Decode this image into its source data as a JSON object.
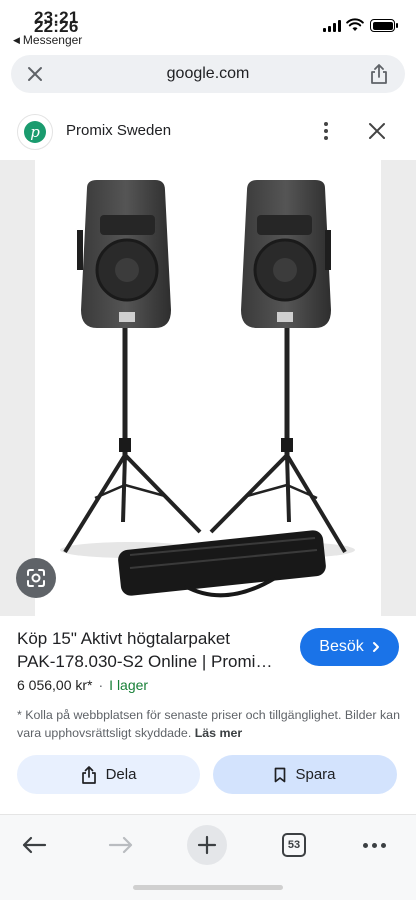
{
  "status_bar": {
    "time_top": "23:21",
    "time_bottom": "22:26",
    "back_app": "Messenger"
  },
  "address_bar": {
    "url": "google.com"
  },
  "site": {
    "name": "Promix Sweden",
    "logo_letter": "p"
  },
  "product": {
    "title_line1": "Köp 15\" Aktivt högtalarpaket",
    "title_line2": "PAK-178.030-S2 Online | Promi…",
    "visit_label": "Besök",
    "price": "6 056,00 kr*",
    "separator": "·",
    "stock": "I lager",
    "note": "* Kolla på webbplatsen för senaste priser och tillgänglighet. Bilder kan vara upphovsrättsligt skyddade.",
    "read_more": "Läs mer"
  },
  "actions": {
    "share_label": "Dela",
    "save_label": "Spara"
  },
  "toolbar": {
    "tab_count": "53"
  },
  "colors": {
    "accent": "#1a73e8",
    "stock_green": "#188038",
    "logo_green": "#1a9b6e"
  }
}
